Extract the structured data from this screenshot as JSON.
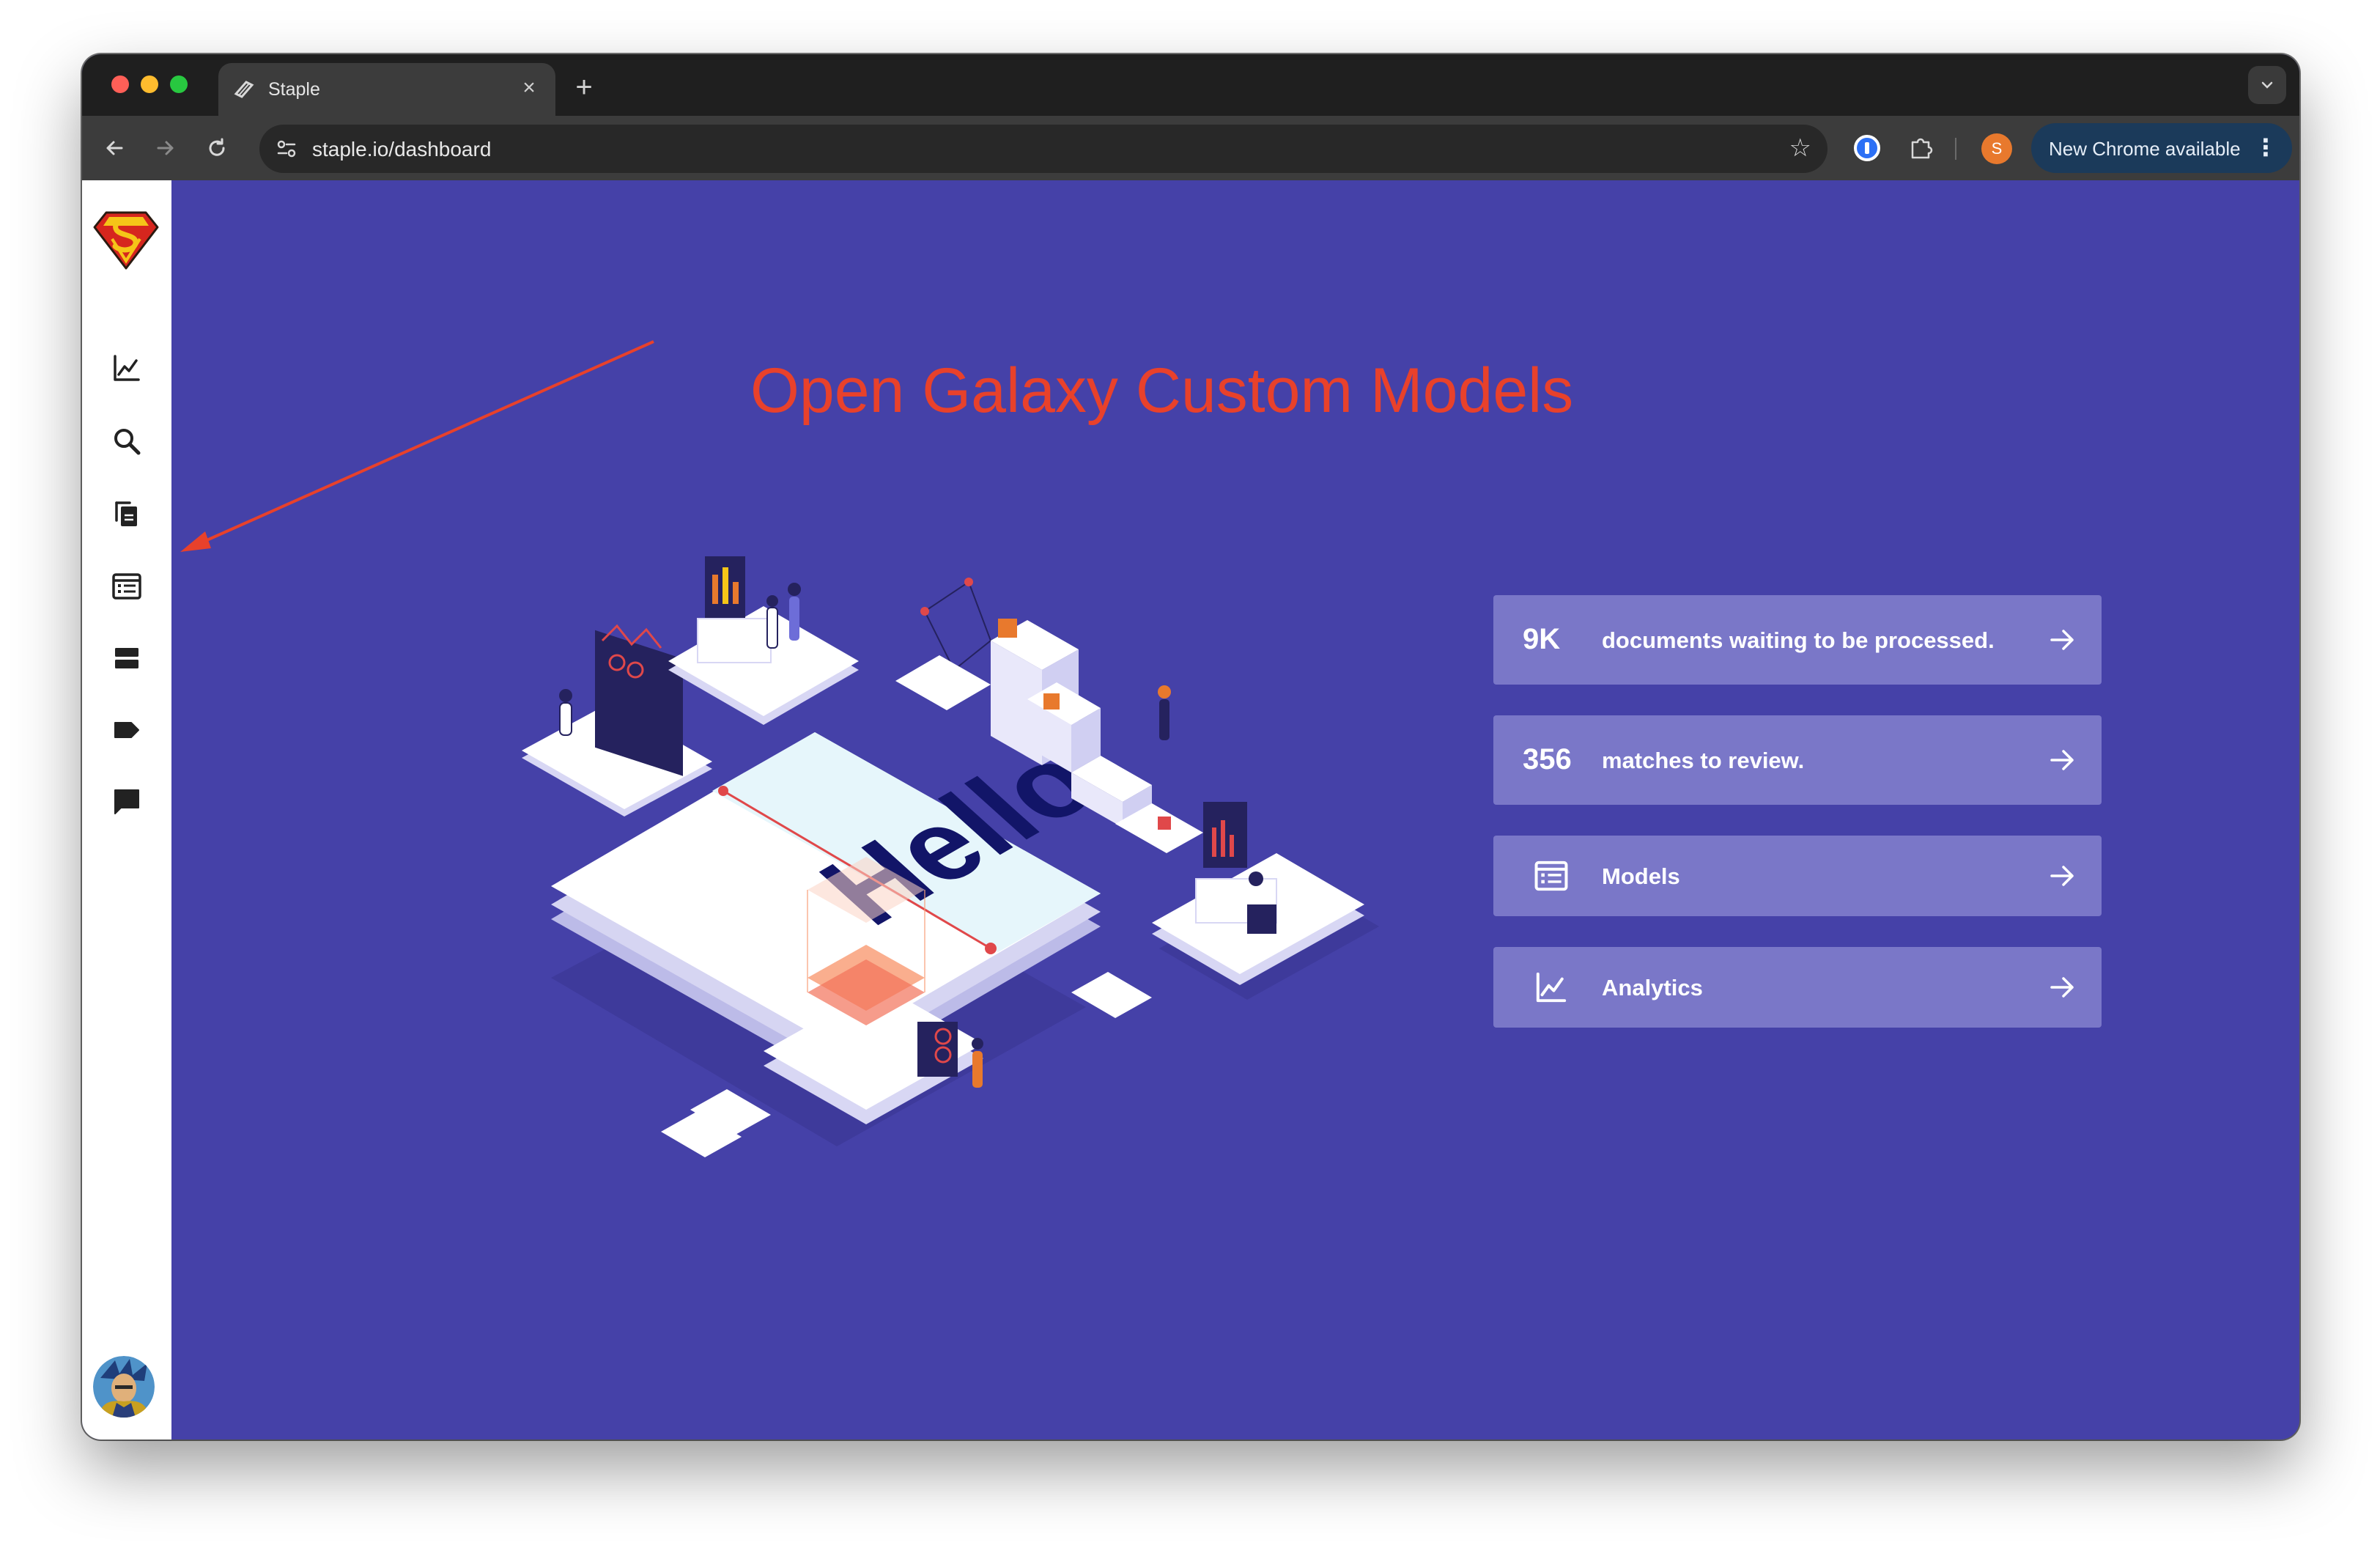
{
  "browser": {
    "tab_title": "Staple",
    "tab_close": "×",
    "new_tab": "+",
    "url": "staple.io/dashboard",
    "update_label": "New Chrome available",
    "profile_initial": "S"
  },
  "annotation": {
    "text": "Open Galaxy Custom Models",
    "color": "#e8412b"
  },
  "sidebar": {
    "items": [
      {
        "icon": "analytics-icon"
      },
      {
        "icon": "search-icon"
      },
      {
        "icon": "documents-icon"
      },
      {
        "icon": "models-icon"
      },
      {
        "icon": "storage-icon"
      },
      {
        "icon": "label-icon"
      },
      {
        "icon": "comment-icon"
      }
    ]
  },
  "illustration": {
    "text": "Hello"
  },
  "cards": [
    {
      "value": "9K",
      "label": "documents waiting to be processed."
    },
    {
      "value": "356",
      "label": "matches to review."
    },
    {
      "icon": "models-icon",
      "label": "Models"
    },
    {
      "icon": "analytics-icon",
      "label": "Analytics"
    }
  ],
  "colors": {
    "background": "#4541a8",
    "card": "#7a77c8",
    "sidebar": "#ffffff"
  }
}
